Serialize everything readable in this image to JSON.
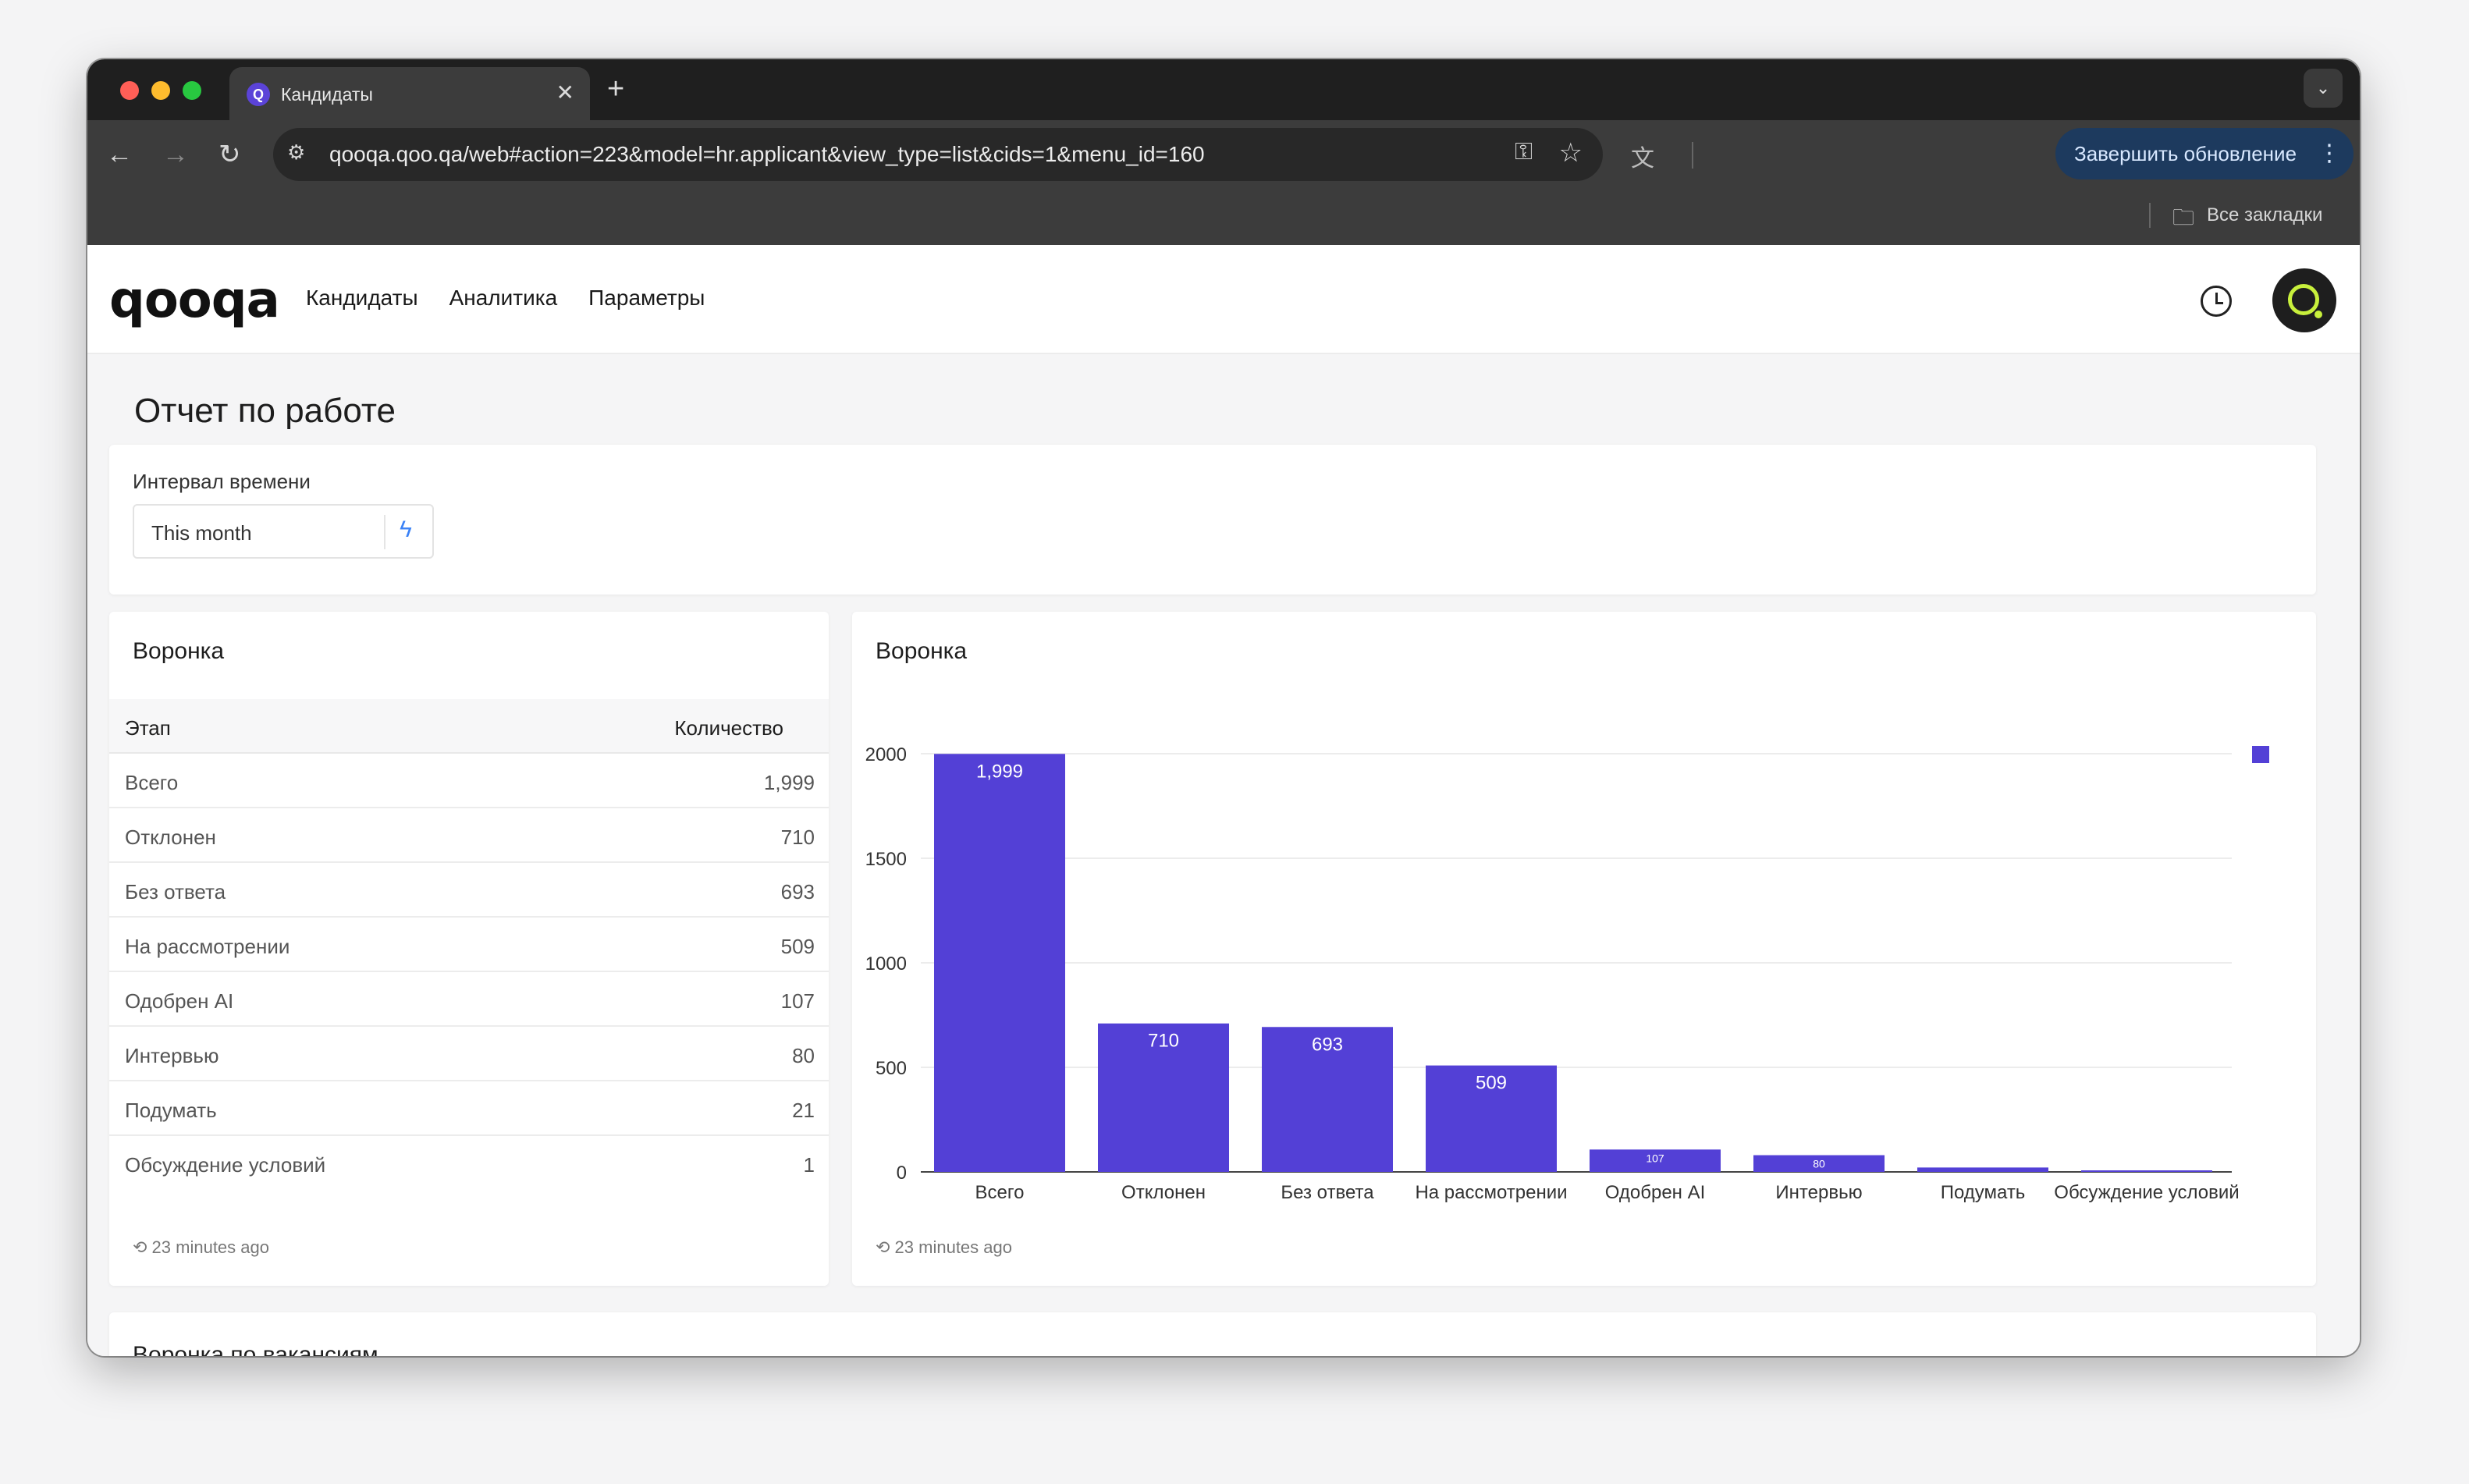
{
  "browser": {
    "tab_title": "Кандидаты",
    "url": "qooqa.qoo.qa/web#action=223&model=hr.applicant&view_type=list&cids=1&menu_id=160",
    "update_button": "Завершить обновление",
    "bookmarks_label": "Все закладки"
  },
  "app": {
    "logo": "qooqa",
    "nav": [
      "Кандидаты",
      "Аналитика",
      "Параметры"
    ]
  },
  "page": {
    "title": "Отчет по работе",
    "filter": {
      "label": "Интервал времени",
      "value": "This month"
    }
  },
  "funnel_table": {
    "title": "Воронка",
    "col_stage": "Этап",
    "col_count": "Количество",
    "rows": [
      {
        "stage": "Всего",
        "count": "1,999"
      },
      {
        "stage": "Отклонен",
        "count": "710"
      },
      {
        "stage": "Без ответа",
        "count": "693"
      },
      {
        "stage": "На рассмотрении",
        "count": "509"
      },
      {
        "stage": "Одобрен AI",
        "count": "107"
      },
      {
        "stage": "Интервью",
        "count": "80"
      },
      {
        "stage": "Подумать",
        "count": "21"
      },
      {
        "stage": "Обсуждение условий",
        "count": "1"
      }
    ],
    "updated": "23 minutes ago"
  },
  "funnel_chart": {
    "title": "Воронка",
    "updated": "23 minutes ago"
  },
  "chart_data": {
    "type": "bar",
    "categories": [
      "Всего",
      "Отклонен",
      "Без ответа",
      "На рассмотрении",
      "Одобрен AI",
      "Интервью",
      "Подумать",
      "Обсуждение условий"
    ],
    "values": [
      1999,
      710,
      693,
      509,
      107,
      80,
      21,
      1
    ],
    "value_labels": [
      "1,999",
      "710",
      "693",
      "509",
      "107",
      "80",
      "",
      ""
    ],
    "yticks": [
      0,
      500,
      1000,
      1500,
      2000
    ],
    "ylim": [
      0,
      2000
    ],
    "color": "#5340d6",
    "legend": "top-right",
    "grid": true
  },
  "bottom_section": {
    "title": "Воронка по вакансиям"
  },
  "icons": {
    "tab_favicon": "search-icon",
    "history": "clock-icon",
    "filter_action": "bolt-icon",
    "updated": "history-icon"
  }
}
